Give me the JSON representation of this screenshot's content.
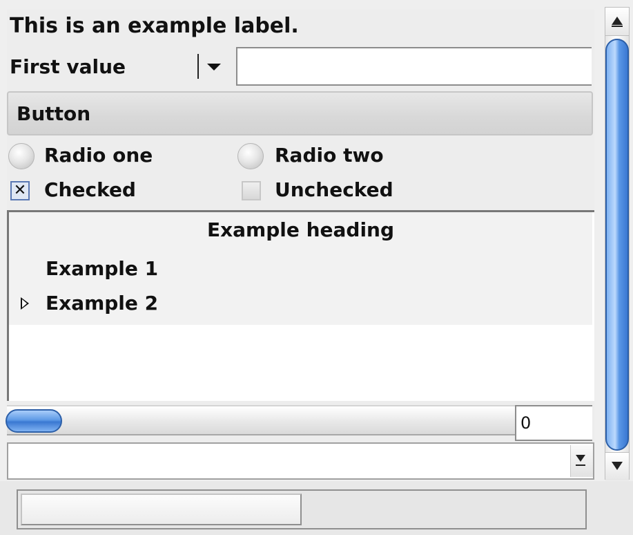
{
  "label": {
    "text": "This is an example label."
  },
  "combo": {
    "selected": "First value",
    "entry_value": ""
  },
  "button": {
    "label": "Button"
  },
  "radios": [
    {
      "label": "Radio one",
      "selected": false
    },
    {
      "label": "Radio two",
      "selected": false
    }
  ],
  "checks": [
    {
      "label": "Checked",
      "checked": true,
      "mark": "✕"
    },
    {
      "label": "Unchecked",
      "checked": false
    }
  ],
  "tree": {
    "heading": "Example heading",
    "items": [
      {
        "label": "Example 1",
        "expandable": false
      },
      {
        "label": "Example 2",
        "expandable": true,
        "expanded": false
      }
    ]
  },
  "hscale": {
    "value": 0,
    "display": "0"
  },
  "combo2": {
    "value": ""
  },
  "progress": {
    "fraction": 0.5
  },
  "scrollbar": {
    "icons": [
      "arrow-up-icon",
      "arrow-down-icon"
    ]
  },
  "colors": {
    "accent": "#5e9ae6",
    "accent_border": "#2c5fa8"
  }
}
